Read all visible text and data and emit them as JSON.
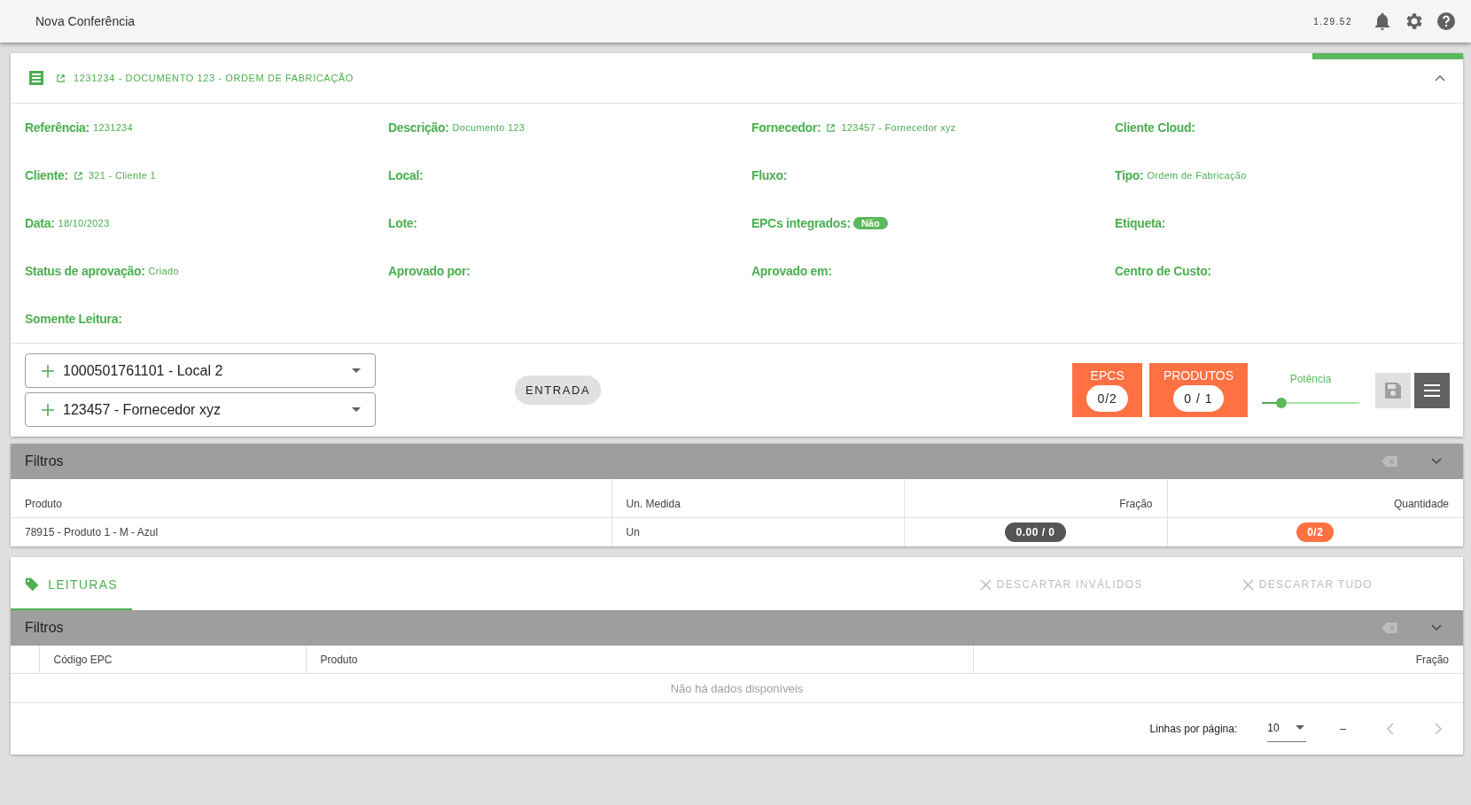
{
  "app_bar": {
    "title": "Nova Conferência",
    "version": "1.29.52"
  },
  "document": {
    "title": "1231234 - DOCUMENTO 123 - ORDEM DE FABRICAÇÃO",
    "expanded": true,
    "fields": [
      {
        "label": "Referência:",
        "kind": "text",
        "value": "1231234"
      },
      {
        "label": "Descrição:",
        "kind": "text",
        "value": "Documento 123"
      },
      {
        "label": "Fornecedor:",
        "kind": "link",
        "value": "123457 - Fornecedor xyz"
      },
      {
        "label": "Cliente Cloud:"
      },
      {
        "label": "Cliente:",
        "kind": "link",
        "value": "321 - Cliente 1"
      },
      {
        "label": "Local:"
      },
      {
        "label": "Fluxo:"
      },
      {
        "label": "Tipo:",
        "kind": "text",
        "value": "Ordem de Fabricação"
      },
      {
        "label": "Data:",
        "kind": "text",
        "value": "18/10/2023"
      },
      {
        "label": "Lote:"
      },
      {
        "label": "EPCs integrados:",
        "kind": "badge",
        "value": "Não"
      },
      {
        "label": "Etiqueta:"
      },
      {
        "label": "Status de aprovação:",
        "kind": "text",
        "value": "Criado"
      },
      {
        "label": "Aprovado por:"
      },
      {
        "label": "Aprovado em:"
      },
      {
        "label": "Centro de Custo:"
      },
      {
        "label": "Somente Leitura:"
      }
    ],
    "selects": [
      {
        "value": "1000501761101 - Local 2"
      },
      {
        "value": "123457 - Fornecedor xyz"
      }
    ],
    "direction": "ENTRADA",
    "counters": [
      {
        "label": "EPCS",
        "value": "0/2"
      },
      {
        "label": "PRODUTOS",
        "value": "0 / 1"
      }
    ],
    "power": {
      "label": "Potência",
      "level": 0.2
    }
  },
  "products": {
    "filters": {
      "title": "Filtros",
      "expanded": false
    },
    "columns": [
      {
        "label": "Produto",
        "kind": "text"
      },
      {
        "label": "Un. Medida",
        "kind": "text"
      },
      {
        "label": "Fração",
        "kind": "number"
      },
      {
        "label": "Quantidade",
        "kind": "number"
      }
    ],
    "rows": [
      [
        {
          "kind": "text",
          "text": "78915 - Produto 1 - M - Azul"
        },
        {
          "kind": "text",
          "text": "Un"
        },
        {
          "kind": "badge",
          "text": "0.00 / 0",
          "color": "#555555"
        },
        {
          "kind": "badge",
          "text": "0/2",
          "color": "#ff7043"
        }
      ]
    ]
  },
  "readings": {
    "tab": {
      "label": "LEITURAS",
      "selected": true
    },
    "actions": [
      {
        "label": "DESCARTAR INVÁLIDOS",
        "disabled": true
      },
      {
        "label": "DESCARTAR TUDO",
        "disabled": true
      }
    ],
    "filters": {
      "title": "Filtros",
      "expanded": false
    },
    "columns": [
      {
        "label": "Código EPC",
        "kind": "text"
      },
      {
        "label": "Produto",
        "kind": "text"
      },
      {
        "label": "Fração",
        "kind": "number"
      }
    ],
    "empty": "Não há dados disponíveis",
    "footer": {
      "rows_label": "Linhas por página:",
      "rows_per_page": "10",
      "range": "–"
    }
  }
}
